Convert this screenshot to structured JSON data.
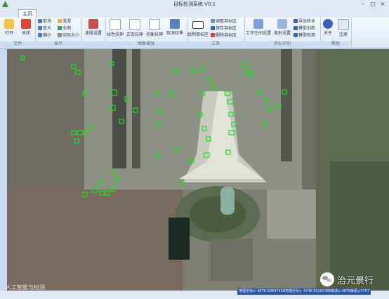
{
  "window": {
    "title": "目标检测系统 V0.1"
  },
  "tabs": [
    {
      "label": "主页"
    }
  ],
  "ribbon": {
    "file": {
      "label": "文件",
      "open": "打开",
      "close": "关闭"
    },
    "display": {
      "label": "显示",
      "cancel": "取消",
      "roam": "漫游",
      "zoom_in": "放大",
      "full": "全图",
      "zoom_out": "缩小",
      "actual": "实际大小"
    },
    "band": {
      "label": "",
      "button": "波段设置"
    },
    "enhance": {
      "label": "图像增强",
      "linear": "线性拉伸",
      "normal": "正态拉伸",
      "equalize": "均衡拉伸",
      "cancel": "取消拉伸"
    },
    "tools": {
      "label": "工具",
      "draw": "绘制目标区",
      "adjust": "调整目标区",
      "save": "保存目标区",
      "delete": "删除目标区"
    },
    "recognize": {
      "label": "目标识别",
      "workspace": "工作空间设置",
      "category": "类别设置",
      "export": "导出样本",
      "train": "模型训练",
      "detect": "模型检测"
    },
    "help": {
      "label": "帮助",
      "about": "关于",
      "register": "注册"
    }
  },
  "status": {
    "coords": "地理坐标x: 4876.00847458地理坐标y: 4746.50282486像素x:4876像素y:4757"
  },
  "watermark": {
    "left": "人工智能与检测",
    "right": "治元景行"
  },
  "colors": {
    "detection": "#1fe01f",
    "ribbon": "#dde8f5"
  }
}
